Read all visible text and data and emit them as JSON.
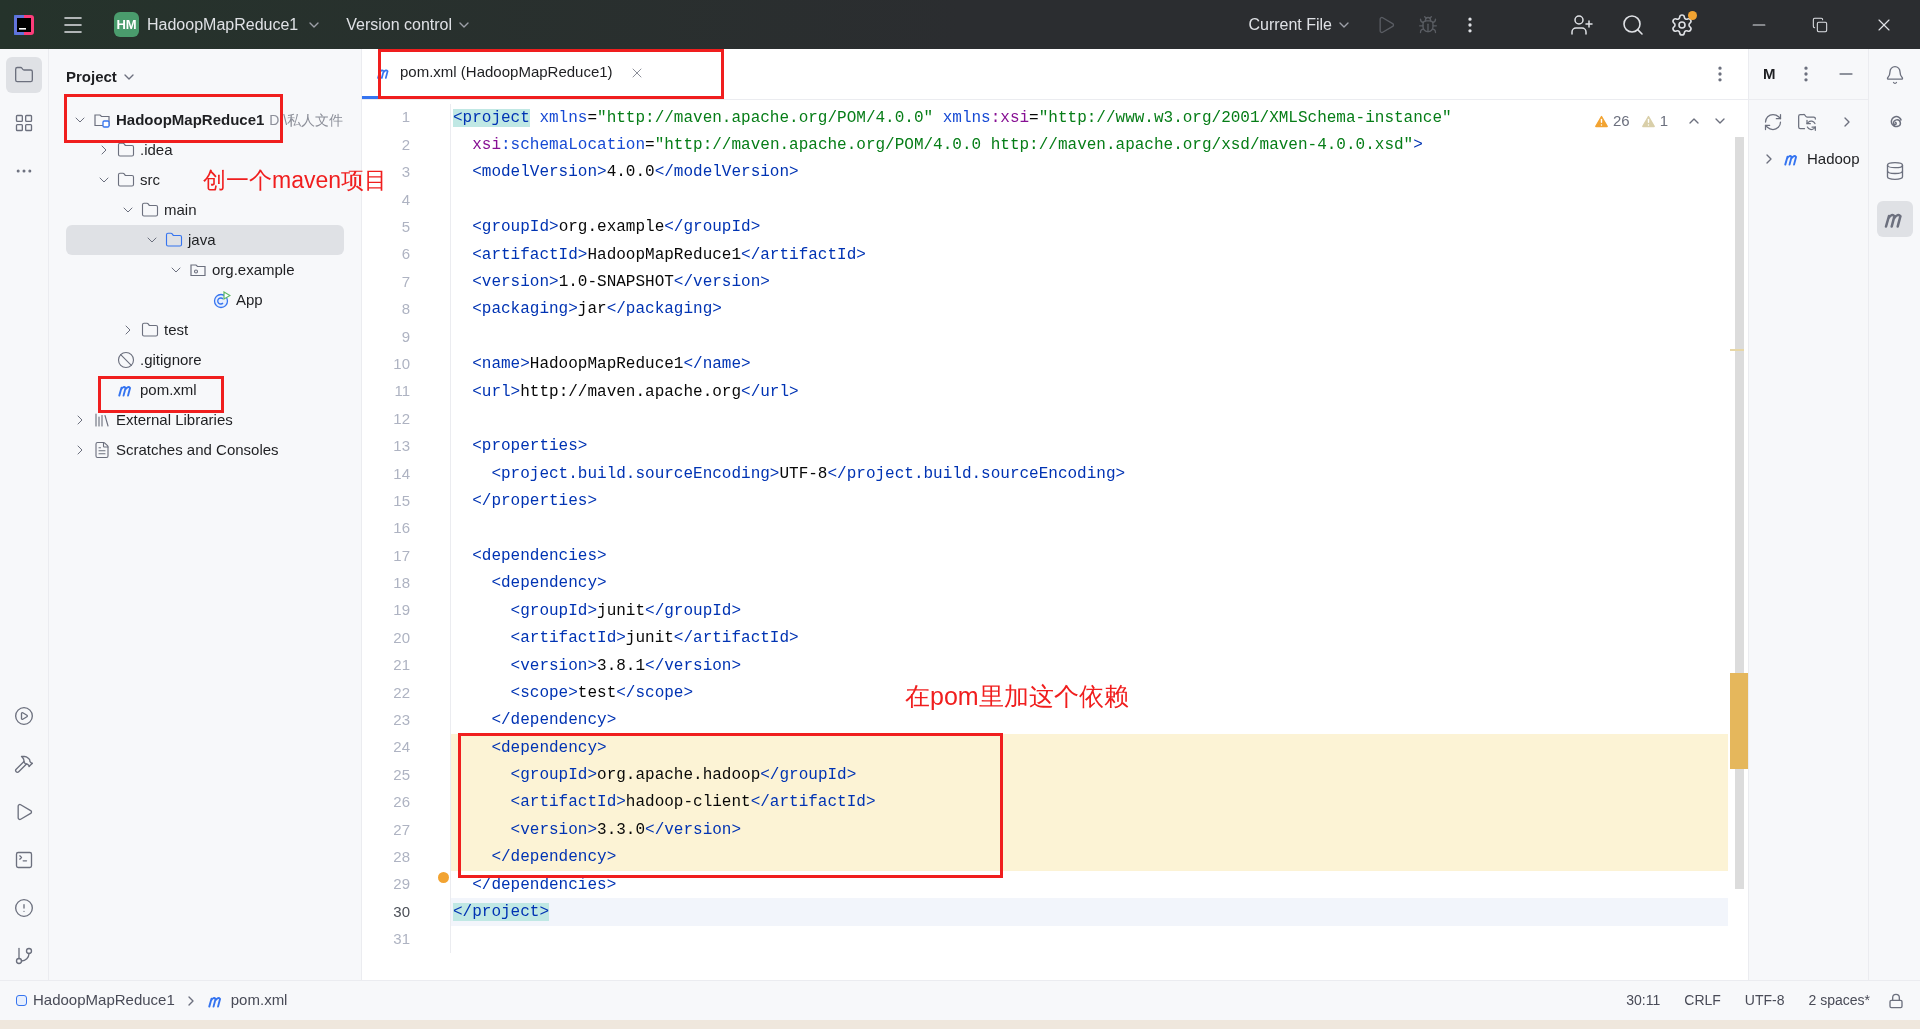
{
  "title_bar": {
    "project_badge": "HM",
    "project_name": "HadoopMapReduce1",
    "vcs": "Version control",
    "run_config": "Current File",
    "run_enabled": false,
    "settings_badge": true
  },
  "left_toolbar_top": [
    {
      "kind": "project",
      "selected": true
    },
    {
      "kind": "structure",
      "selected": false
    },
    {
      "kind": "more",
      "selected": false
    }
  ],
  "left_toolbar_bottom": [
    {
      "kind": "services",
      "selected": false
    },
    {
      "kind": "build",
      "selected": false
    },
    {
      "kind": "run",
      "selected": false
    },
    {
      "kind": "terminal",
      "selected": false
    },
    {
      "kind": "problems",
      "selected": false
    },
    {
      "kind": "git",
      "selected": false
    }
  ],
  "project_panel": {
    "title": "Project",
    "tree": [
      {
        "kind": "module",
        "label": "HadoopMapReduce1",
        "hint": "D:\\私人文件",
        "bold": true,
        "expanded": true,
        "selected": false,
        "children": [
          {
            "kind": "folder",
            "label": ".idea",
            "expanded": false,
            "selected": false
          },
          {
            "kind": "folder",
            "label": "src",
            "expanded": true,
            "selected": false,
            "children": [
              {
                "kind": "folder",
                "label": "main",
                "expanded": true,
                "selected": false,
                "children": [
                  {
                    "kind": "source",
                    "label": "java",
                    "expanded": true,
                    "selected": true,
                    "children": [
                      {
                        "kind": "package",
                        "label": "org.example",
                        "expanded": true,
                        "selected": false,
                        "children": [
                          {
                            "kind": "class",
                            "label": "App",
                            "selected": false
                          }
                        ]
                      }
                    ]
                  }
                ]
              },
              {
                "kind": "folder",
                "label": "test",
                "expanded": false,
                "selected": false
              }
            ]
          },
          {
            "kind": "ignore",
            "label": ".gitignore",
            "selected": false
          },
          {
            "kind": "maven",
            "label": "pom.xml",
            "selected": false
          }
        ]
      },
      {
        "kind": "libraries",
        "label": "External Libraries",
        "expanded": false,
        "selected": false
      },
      {
        "kind": "scratches",
        "label": "Scratches and Consoles",
        "expanded": false,
        "selected": false
      }
    ]
  },
  "editor": {
    "tab": {
      "label": "pom.xml (HadoopMapReduce1)",
      "selected": true
    },
    "warnings": "26",
    "weak_warnings": "1",
    "lines": [
      {
        "number": "1",
        "highlighted": false,
        "current": false,
        "tokens": [
          {
            "kind": "match",
            "text": "<project"
          },
          {
            "kind": "attr",
            "text": " xmlns"
          },
          {
            "kind": "text",
            "text": "="
          },
          {
            "kind": "value",
            "text": "\"http://maven.apache.org/POM/4.0.0\""
          },
          {
            "kind": "attr",
            "text": " xmlns"
          },
          {
            "kind": "ns",
            "text": ":xsi"
          },
          {
            "kind": "text",
            "text": "="
          },
          {
            "kind": "value",
            "text": "\"http://www.w3.org/2001/XMLSchema-instance\""
          }
        ]
      },
      {
        "number": "2",
        "highlighted": false,
        "current": false,
        "tokens": [
          {
            "kind": "ns",
            "text": "  xsi"
          },
          {
            "kind": "attr",
            "text": ":schemaLocation"
          },
          {
            "kind": "text",
            "text": "="
          },
          {
            "kind": "value",
            "text": "\"http://maven.apache.org/POM/4.0.0 http://maven.apache.org/xsd/maven-4.0.0.xsd\""
          },
          {
            "kind": "tag",
            "text": ">"
          }
        ]
      },
      {
        "number": "3",
        "highlighted": false,
        "current": false,
        "tokens": [
          {
            "kind": "tag",
            "text": "  <modelVersion>"
          },
          {
            "kind": "text",
            "text": "4.0.0"
          },
          {
            "kind": "tag",
            "text": "</modelVersion>"
          }
        ]
      },
      {
        "number": "4",
        "current": false
      },
      {
        "number": "5",
        "highlighted": false,
        "current": false,
        "tokens": [
          {
            "kind": "tag",
            "text": "  <groupId>"
          },
          {
            "kind": "text",
            "text": "org.example"
          },
          {
            "kind": "tag",
            "text": "</groupId>"
          }
        ]
      },
      {
        "number": "6",
        "highlighted": false,
        "current": false,
        "tokens": [
          {
            "kind": "tag",
            "text": "  <artifactId>"
          },
          {
            "kind": "text",
            "text": "HadoopMapReduce1"
          },
          {
            "kind": "tag",
            "text": "</artifactId>"
          }
        ]
      },
      {
        "number": "7",
        "highlighted": false,
        "current": false,
        "tokens": [
          {
            "kind": "tag",
            "text": "  <version>"
          },
          {
            "kind": "text",
            "text": "1.0-SNAPSHOT"
          },
          {
            "kind": "tag",
            "text": "</version>"
          }
        ]
      },
      {
        "number": "8",
        "highlighted": false,
        "current": false,
        "tokens": [
          {
            "kind": "tag",
            "text": "  <packaging>"
          },
          {
            "kind": "text",
            "text": "jar"
          },
          {
            "kind": "tag",
            "text": "</packaging>"
          }
        ]
      },
      {
        "number": "9",
        "current": false
      },
      {
        "number": "10",
        "highlighted": false,
        "current": false,
        "tokens": [
          {
            "kind": "tag",
            "text": "  <name>"
          },
          {
            "kind": "text",
            "text": "HadoopMapReduce1"
          },
          {
            "kind": "tag",
            "text": "</name>"
          }
        ]
      },
      {
        "number": "11",
        "highlighted": false,
        "current": false,
        "tokens": [
          {
            "kind": "tag",
            "text": "  <url>"
          },
          {
            "kind": "text",
            "text": "http://maven.apache.org"
          },
          {
            "kind": "tag",
            "text": "</url>"
          }
        ]
      },
      {
        "number": "12",
        "current": false
      },
      {
        "number": "13",
        "highlighted": false,
        "current": false,
        "tokens": [
          {
            "kind": "tag",
            "text": "  <properties>"
          }
        ]
      },
      {
        "number": "14",
        "highlighted": false,
        "current": false,
        "tokens": [
          {
            "kind": "tag",
            "text": "    <project.build.sourceEncoding>"
          },
          {
            "kind": "text",
            "text": "UTF-8"
          },
          {
            "kind": "tag",
            "text": "</project.build.sourceEncoding>"
          }
        ]
      },
      {
        "number": "15",
        "highlighted": false,
        "current": false,
        "tokens": [
          {
            "kind": "tag",
            "text": "  </properties>"
          }
        ]
      },
      {
        "number": "16",
        "current": false
      },
      {
        "number": "17",
        "highlighted": false,
        "current": false,
        "tokens": [
          {
            "kind": "tag",
            "text": "  <dependencies>"
          }
        ]
      },
      {
        "number": "18",
        "highlighted": false,
        "current": false,
        "tokens": [
          {
            "kind": "tag",
            "text": "    <dependency>"
          }
        ]
      },
      {
        "number": "19",
        "highlighted": false,
        "current": false,
        "tokens": [
          {
            "kind": "tag",
            "text": "      <groupId>"
          },
          {
            "kind": "text",
            "text": "junit"
          },
          {
            "kind": "tag",
            "text": "</groupId>"
          }
        ]
      },
      {
        "number": "20",
        "highlighted": false,
        "current": false,
        "tokens": [
          {
            "kind": "tag",
            "text": "      <artifactId>"
          },
          {
            "kind": "text",
            "text": "junit"
          },
          {
            "kind": "tag",
            "text": "</artifactId>"
          }
        ]
      },
      {
        "number": "21",
        "highlighted": false,
        "current": false,
        "tokens": [
          {
            "kind": "tag",
            "text": "      <version>"
          },
          {
            "kind": "text",
            "text": "3.8.1"
          },
          {
            "kind": "tag",
            "text": "</version>"
          }
        ]
      },
      {
        "number": "22",
        "highlighted": false,
        "current": false,
        "tokens": [
          {
            "kind": "tag",
            "text": "      <scope>"
          },
          {
            "kind": "text",
            "text": "test"
          },
          {
            "kind": "tag",
            "text": "</scope>"
          }
        ]
      },
      {
        "number": "23",
        "highlighted": false,
        "current": false,
        "tokens": [
          {
            "kind": "tag",
            "text": "    </dependency>"
          }
        ]
      },
      {
        "number": "24",
        "highlighted": true,
        "current": false,
        "tokens": [
          {
            "kind": "tag",
            "text": "    <dependency>"
          }
        ]
      },
      {
        "number": "25",
        "highlighted": true,
        "current": false,
        "tokens": [
          {
            "kind": "tag",
            "text": "      <groupId>"
          },
          {
            "kind": "text",
            "text": "org.apache.hadoop"
          },
          {
            "kind": "tag",
            "text": "</groupId>"
          }
        ]
      },
      {
        "number": "26",
        "highlighted": true,
        "current": false,
        "tokens": [
          {
            "kind": "tag",
            "text": "      <artifactId>"
          },
          {
            "kind": "text",
            "text": "hadoop-client"
          },
          {
            "kind": "tag",
            "text": "</artifactId>"
          }
        ]
      },
      {
        "number": "27",
        "highlighted": true,
        "current": false,
        "tokens": [
          {
            "kind": "tag",
            "text": "      <version>"
          },
          {
            "kind": "text",
            "text": "3.3.0"
          },
          {
            "kind": "tag",
            "text": "</version>"
          }
        ]
      },
      {
        "number": "28",
        "highlighted": true,
        "current": false,
        "tokens": [
          {
            "kind": "tag",
            "text": "    </dependency>"
          }
        ]
      },
      {
        "number": "29",
        "highlighted": false,
        "current": false,
        "tokens": [
          {
            "kind": "tag",
            "text": "  </dependencies>"
          }
        ]
      },
      {
        "number": "30",
        "highlighted": false,
        "current": true,
        "tokens": [
          {
            "kind": "match",
            "text": "</project>"
          }
        ]
      },
      {
        "number": "31",
        "current": false
      }
    ]
  },
  "maven_panel": {
    "title": "M",
    "tree": [
      {
        "label": "Hadoop",
        "expanded": false
      }
    ]
  },
  "right_toolbar": [
    {
      "kind": "notifications",
      "selected": false
    },
    {
      "kind": "ai",
      "selected": false
    },
    {
      "kind": "database",
      "selected": false
    },
    {
      "kind": "maven",
      "selected": true
    }
  ],
  "breadcrumbs": [
    {
      "kind": "module",
      "label": "HadoopMapReduce1"
    },
    {
      "kind": "maven",
      "label": "pom.xml"
    }
  ],
  "status_bar": [
    "30:11",
    "CRLF",
    "UTF-8",
    "2 spaces*"
  ],
  "annotations": {
    "project_note": "创一个maven项目",
    "dependency_note": "在pom里加这个依赖"
  }
}
